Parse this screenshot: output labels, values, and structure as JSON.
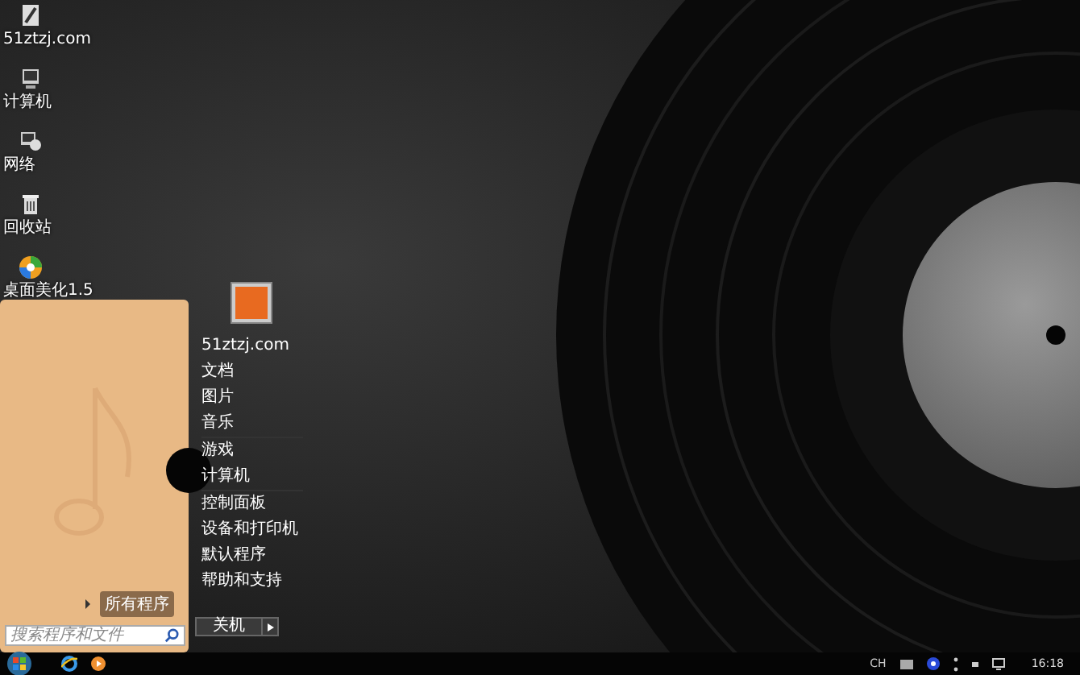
{
  "desktop_icons": [
    {
      "kind": "document",
      "label": "51ztzj.com"
    },
    {
      "kind": "computer",
      "label": "计算机"
    },
    {
      "kind": "network",
      "label": "网络"
    },
    {
      "kind": "trash",
      "label": "回收站"
    },
    {
      "kind": "app",
      "label": "桌面美化1.5"
    }
  ],
  "start_menu": {
    "all_programs": "所有程序",
    "search": {
      "placeholder": "搜索程序和文件"
    },
    "right_groups": [
      [
        "51ztzj.com",
        "文档",
        "图片",
        "音乐"
      ],
      [
        "游戏",
        "计算机"
      ],
      [
        "控制面板",
        "设备和打印机",
        "默认程序",
        "帮助和支持"
      ]
    ],
    "shutdown": "关机"
  },
  "taskbar": {
    "language": "CH",
    "clock": "16:18"
  }
}
